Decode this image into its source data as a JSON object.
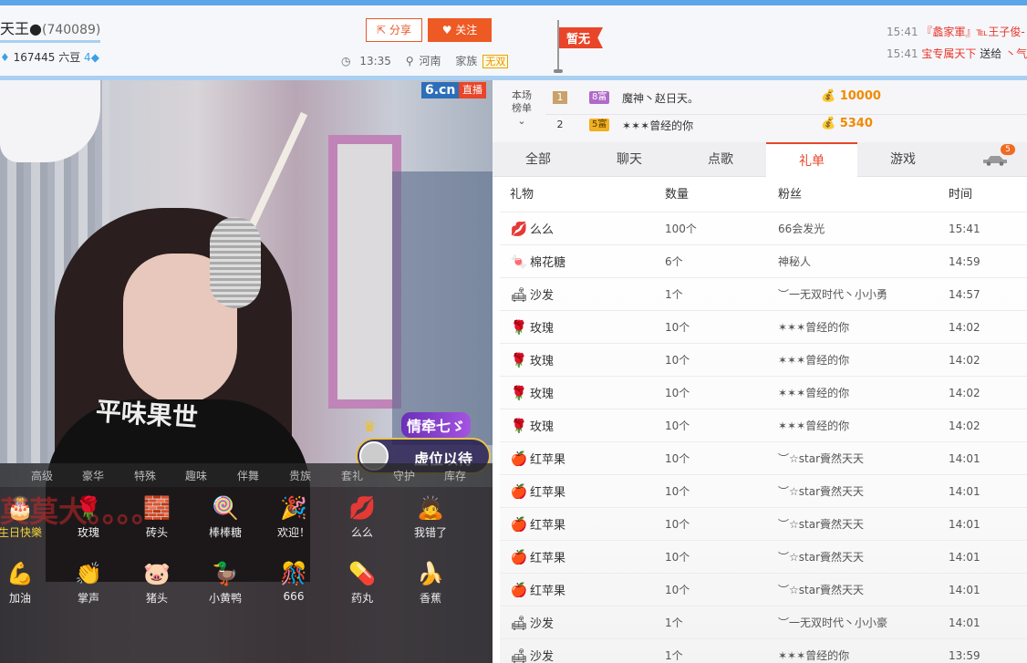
{
  "header": {
    "host_name": "天王",
    "room_id": "(740089)",
    "stats": "167445 六豆",
    "level_badge": "4",
    "share_label": "分享",
    "follow_label": "关注",
    "time": "13:35",
    "location": "河南",
    "family_label": "家族",
    "family_tag": "无双",
    "flag_text": "暂无"
  },
  "news": [
    {
      "time": "15:41",
      "text": "『蠡家軍』℡王子俊-"
    },
    {
      "time": "15:41",
      "text": "宝专属天下",
      "action": "送给",
      "target": "丶气"
    }
  ],
  "video": {
    "logo": "6.cn",
    "live_badge": "直播",
    "shirt_text": "平味果世",
    "seat_title": "情牵七ゞ",
    "seat_text": "虚位以待",
    "overlay_text": "莫莫大。。。。"
  },
  "gift_shelf": {
    "tabs": [
      "高级",
      "豪华",
      "特殊",
      "趣味",
      "伴舞",
      "贵族",
      "套礼",
      "守护",
      "库存"
    ],
    "gifts": [
      {
        "label": "生日快樂",
        "icon": "birthday-girl-icon",
        "glyph": "🎂"
      },
      {
        "label": "玫瑰",
        "icon": "rose-icon",
        "glyph": "🌹"
      },
      {
        "label": "砖头",
        "icon": "brick-icon",
        "glyph": "🧱"
      },
      {
        "label": "棒棒糖",
        "icon": "lollipop-icon",
        "glyph": "🍭"
      },
      {
        "label": "欢迎！",
        "icon": "welcome-icon",
        "glyph": "🎉"
      },
      {
        "label": "么么",
        "icon": "kiss-lips-icon",
        "glyph": "💋"
      },
      {
        "label": "我错了",
        "icon": "sorry-icon",
        "glyph": "🙇"
      },
      {
        "label": "加油",
        "icon": "cheer-icon",
        "glyph": "💪"
      },
      {
        "label": "掌声",
        "icon": "clap-icon",
        "glyph": "👏"
      },
      {
        "label": "猪头",
        "icon": "pig-head-icon",
        "glyph": "🐷"
      },
      {
        "label": "小黄鸭",
        "icon": "yellow-duck-icon",
        "glyph": "🦆"
      },
      {
        "label": "666",
        "icon": "666-icon",
        "glyph": "🎊"
      },
      {
        "label": "药丸",
        "icon": "pill-icon",
        "glyph": "💊"
      },
      {
        "label": "香蕉",
        "icon": "banana-icon",
        "glyph": "🍌"
      }
    ]
  },
  "ranking": {
    "label": "本场榜单",
    "rows": [
      {
        "rank": "1",
        "level": "8富",
        "name": "魔神丶赵日天。",
        "gold": "10000"
      },
      {
        "rank": "2",
        "level": "5富",
        "name": "✶✶✶曾经的你",
        "gold": "5340"
      }
    ]
  },
  "tabs": [
    "全部",
    "聊天",
    "点歌",
    "礼单",
    "游戏"
  ],
  "car_badge": "5",
  "gift_table": {
    "headers": [
      "礼物",
      "数量",
      "粉丝",
      "时间"
    ],
    "rows": [
      {
        "gift": "么么",
        "icon": "kiss-lips-icon",
        "glyph": "💋",
        "qty": "100个",
        "fan": "66会发光",
        "time": "15:41"
      },
      {
        "gift": "棉花糖",
        "icon": "cotton-candy-icon",
        "glyph": "🍬",
        "qty": "6个",
        "fan": "神秘人",
        "time": "14:59"
      },
      {
        "gift": "沙发",
        "icon": "sofa-icon",
        "glyph": "🛋",
        "qty": "1个",
        "fan": "︶一无双时代丶小小勇",
        "time": "14:57"
      },
      {
        "gift": "玫瑰",
        "icon": "rose-icon",
        "glyph": "🌹",
        "qty": "10个",
        "fan": "✶✶✶曾经的你",
        "time": "14:02"
      },
      {
        "gift": "玫瑰",
        "icon": "rose-icon",
        "glyph": "🌹",
        "qty": "10个",
        "fan": "✶✶✶曾经的你",
        "time": "14:02"
      },
      {
        "gift": "玫瑰",
        "icon": "rose-icon",
        "glyph": "🌹",
        "qty": "10个",
        "fan": "✶✶✶曾经的你",
        "time": "14:02"
      },
      {
        "gift": "玫瑰",
        "icon": "rose-icon",
        "glyph": "🌹",
        "qty": "10个",
        "fan": "✶✶✶曾经的你",
        "time": "14:02"
      },
      {
        "gift": "红苹果",
        "icon": "red-apple-icon",
        "glyph": "🍎",
        "qty": "10个",
        "fan": "︶☆star賫然天天",
        "time": "14:01"
      },
      {
        "gift": "红苹果",
        "icon": "red-apple-icon",
        "glyph": "🍎",
        "qty": "10个",
        "fan": "︶☆star賫然天天",
        "time": "14:01"
      },
      {
        "gift": "红苹果",
        "icon": "red-apple-icon",
        "glyph": "🍎",
        "qty": "10个",
        "fan": "︶☆star賫然天天",
        "time": "14:01"
      },
      {
        "gift": "红苹果",
        "icon": "red-apple-icon",
        "glyph": "🍎",
        "qty": "10个",
        "fan": "︶☆star賫然天天",
        "time": "14:01"
      },
      {
        "gift": "红苹果",
        "icon": "red-apple-icon",
        "glyph": "🍎",
        "qty": "10个",
        "fan": "︶☆star賫然天天",
        "time": "14:01"
      },
      {
        "gift": "沙发",
        "icon": "sofa-icon",
        "glyph": "🛋",
        "qty": "1个",
        "fan": "︶一无双时代丶小小豪",
        "time": "14:01"
      },
      {
        "gift": "沙发",
        "icon": "sofa-icon",
        "glyph": "🛋",
        "qty": "1个",
        "fan": "✶✶✶曾经的你",
        "time": "13:59"
      }
    ]
  },
  "colors": {
    "accent": "#e9452a",
    "top_border": "#5aa6e8",
    "gold": "#f08a00"
  }
}
